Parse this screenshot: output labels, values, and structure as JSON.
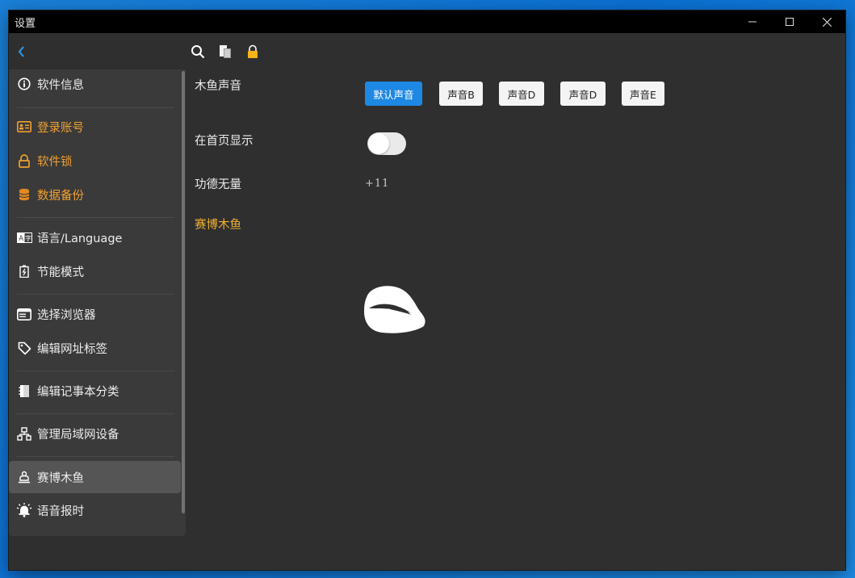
{
  "window": {
    "title": "设置"
  },
  "toolbar": {
    "icons": [
      "back-icon",
      "search-icon",
      "clipboard-icon",
      "lock-icon"
    ]
  },
  "sidebar": {
    "items": [
      {
        "label": "软件信息",
        "icon": "info-icon"
      },
      {
        "label": "登录账号",
        "icon": "id-card-icon",
        "color": "#f0a030"
      },
      {
        "label": "软件锁",
        "icon": "lock-icon",
        "color": "#f0a030"
      },
      {
        "label": "数据备份",
        "icon": "database-icon",
        "color": "#f0a030"
      },
      {
        "label": "语言/Language",
        "icon": "language-icon"
      },
      {
        "label": "节能模式",
        "icon": "battery-icon"
      },
      {
        "label": "选择浏览器",
        "icon": "browser-icon"
      },
      {
        "label": "编辑网址标签",
        "icon": "tag-icon"
      },
      {
        "label": "编辑记事本分类",
        "icon": "notebook-icon"
      },
      {
        "label": "管理局域网设备",
        "icon": "network-icon"
      },
      {
        "label": "赛博木鱼",
        "icon": "woodfish-icon",
        "active": true
      },
      {
        "label": "语音报时",
        "icon": "alarm-bell-icon"
      }
    ]
  },
  "main": {
    "sound_label": "木鱼声音",
    "sound_buttons": [
      "默认声音",
      "声音B",
      "声音D",
      "声音D",
      "声音E"
    ],
    "selected_sound": "默认声音",
    "home_label": "在首页显示",
    "home_toggle": false,
    "merit_label": "功德无量",
    "merit_counter": "+11",
    "section_title": "赛博木鱼"
  },
  "colors": {
    "accent": "#1e88e5",
    "orange": "#f0a030",
    "background": "#2f2f2f",
    "sidebar": "#3a3a3a"
  }
}
